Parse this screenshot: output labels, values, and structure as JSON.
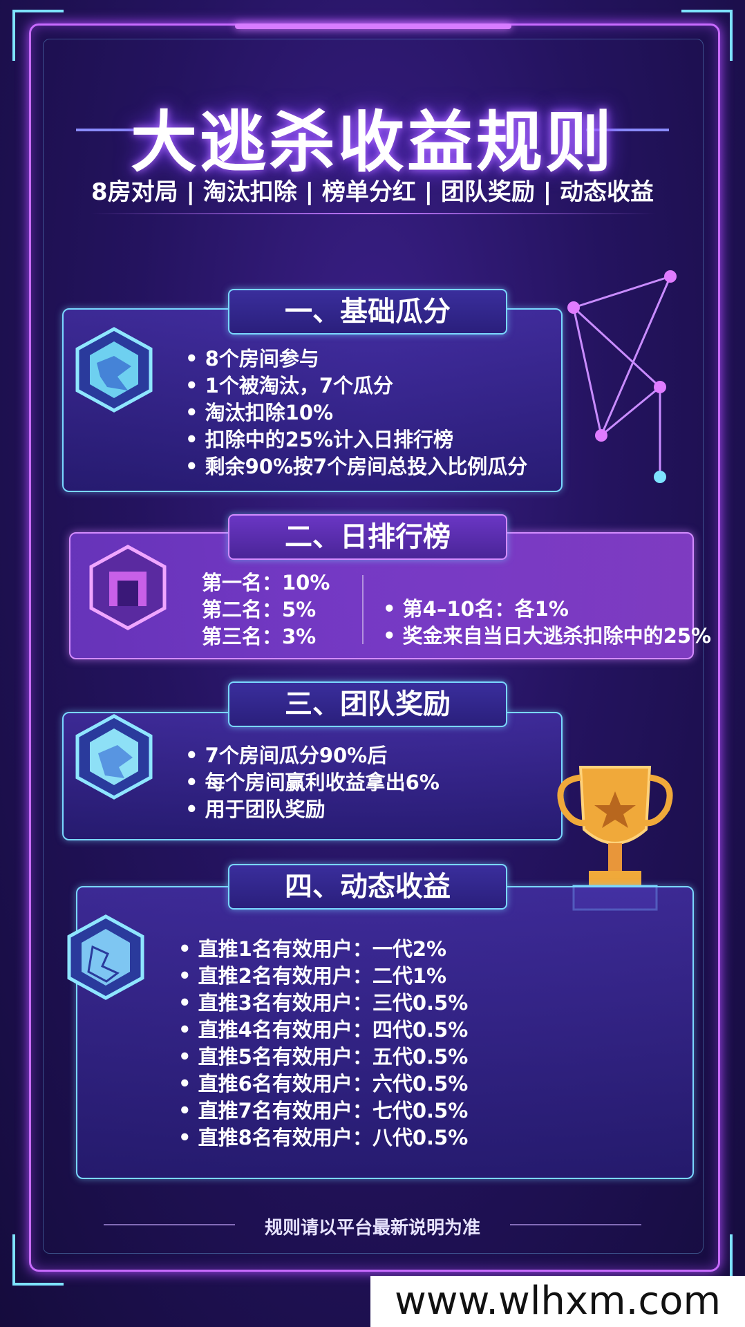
{
  "title": "大逃杀收益规则",
  "subtitle": "8房对局 | 淘汰扣除 | 榜单分红 | 团队奖励 | 动态收益",
  "section1": {
    "heading": "一、基础瓜分",
    "items": [
      "8个房间参与",
      "1个被淘汰，7个瓜分",
      "淘汰扣除10%",
      "扣除中的25%计入日排行榜",
      "剩余90%按7个房间总投入比例瓜分"
    ]
  },
  "section2": {
    "heading": "二、日排行榜",
    "ranks": [
      "第一名：10%",
      "第二名：5%",
      "第三名：3%"
    ],
    "notes": [
      "第4–10名：各1%",
      "奖金来自当日大逃杀扣除中的25%"
    ]
  },
  "section3": {
    "heading": "三、团队奖励",
    "items": [
      "7个房间瓜分90%后",
      "每个房间赢利收益拿出6%",
      "用于团队奖励"
    ]
  },
  "section4": {
    "heading": "四、动态收益",
    "items": [
      "直推1名有效用户：一代2%",
      "直推2名有效用户：二代1%",
      "直推3名有效用户：三代0.5%",
      "直推4名有效用户：四代0.5%",
      "直推5名有效用户：五代0.5%",
      "直推6名有效用户：六代0.5%",
      "直推7名有效用户：七代0.5%",
      "直推8名有效用户：八代0.5%"
    ]
  },
  "footer": "规则请以平台最新说明为准",
  "watermark": "www.wlhxm.com",
  "colors": {
    "frame": "#c86bff",
    "accent_cyan": "#7ad8ff",
    "bg": "#24135f"
  },
  "icons": [
    "map-hex-icon",
    "gate-hex-icon",
    "map-hex-icon",
    "map-hex-icon",
    "network-nodes-icon",
    "trophy-icon"
  ]
}
